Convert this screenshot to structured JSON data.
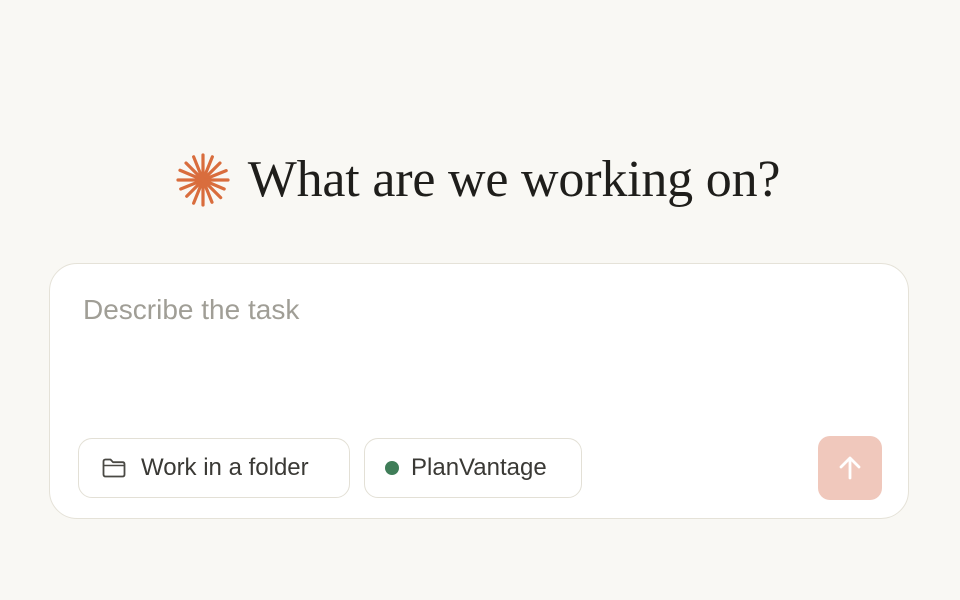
{
  "heading": {
    "title": "What are we working on?",
    "logo_icon": "orange-asterisk-icon"
  },
  "composer": {
    "placeholder": "Describe the task",
    "value": ""
  },
  "chips": {
    "folder": {
      "label": "Work in a folder",
      "icon": "folder-icon"
    },
    "project": {
      "label": "PlanVantage",
      "status_color": "#3f7d58"
    }
  },
  "send_button": {
    "icon": "arrow-up-icon",
    "enabled": false
  },
  "colors": {
    "background": "#f9f8f4",
    "accent": "#d96d3d",
    "send_button_disabled": "#f0c8bc"
  }
}
